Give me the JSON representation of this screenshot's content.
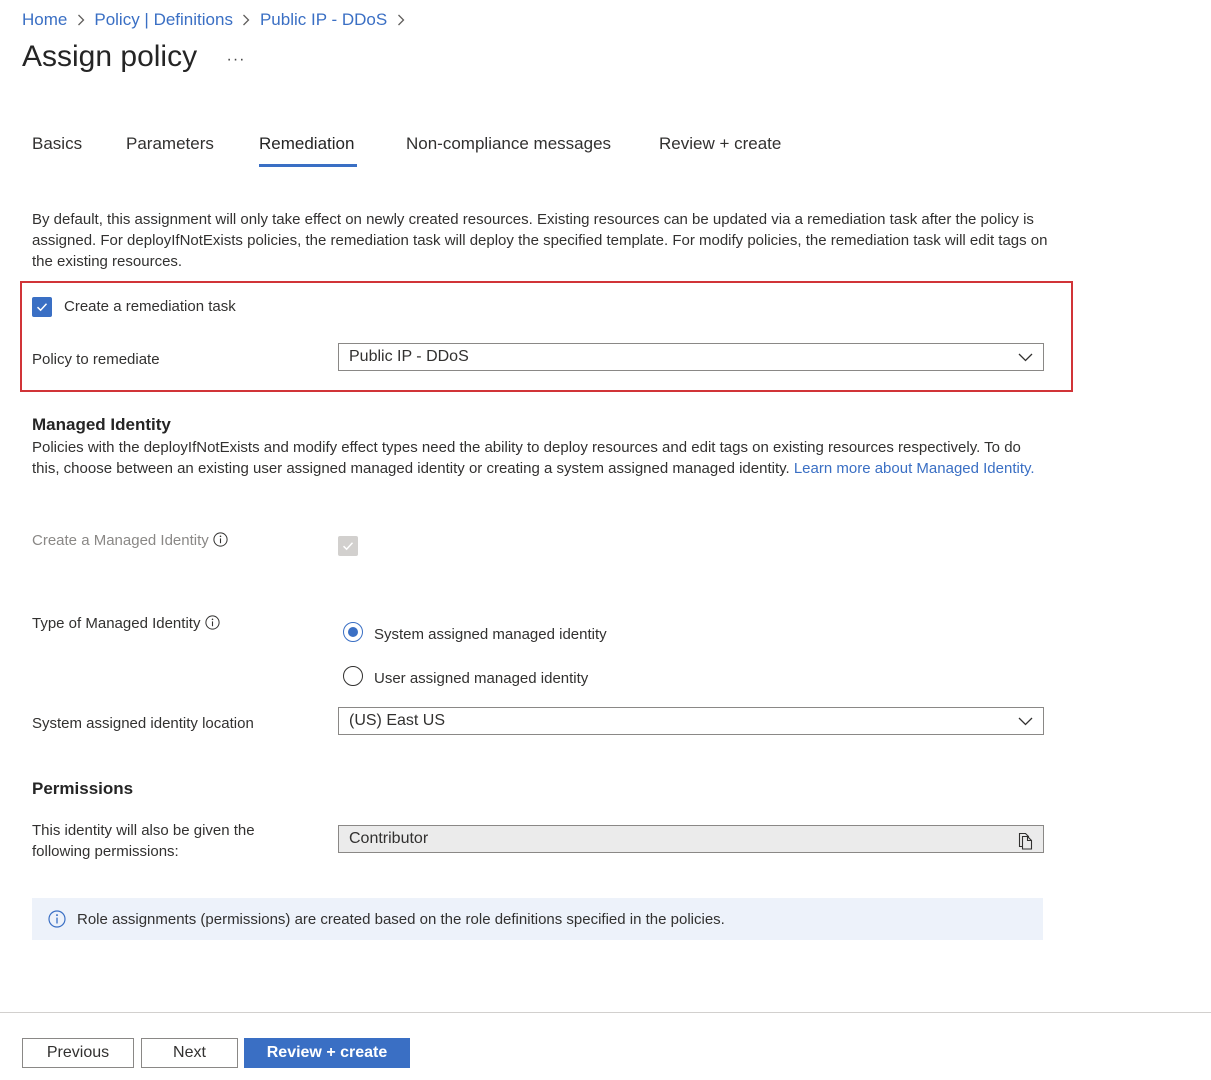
{
  "breadcrumb": {
    "items": [
      "Home",
      "Policy | Definitions",
      "Public IP - DDoS"
    ]
  },
  "page": {
    "title": "Assign policy",
    "more_label": "···"
  },
  "tabs": [
    {
      "label": "Basics"
    },
    {
      "label": "Parameters"
    },
    {
      "label": "Remediation",
      "active": true
    },
    {
      "label": "Non-compliance messages"
    },
    {
      "label": "Review + create"
    }
  ],
  "remediation": {
    "intro": "By default, this assignment will only take effect on newly created resources. Existing resources can be updated via a remediation task after the policy is assigned. For deployIfNotExists policies, the remediation task will deploy the specified template. For modify policies, the remediation task will edit tags on the existing resources.",
    "create_task_label": "Create a remediation task",
    "create_task_checked": true,
    "policy_label": "Policy to remediate",
    "policy_value": "Public IP - DDoS"
  },
  "managed_identity": {
    "title": "Managed Identity",
    "description": "Policies with the deployIfNotExists and modify effect types need the ability to deploy resources and edit tags on existing resources respectively. To do this, choose between an existing user assigned managed identity or creating a system assigned managed identity.",
    "learn_more": "Learn more about Managed Identity.",
    "create_label": "Create a Managed Identity",
    "create_checked": true,
    "type_label": "Type of Managed Identity",
    "options": [
      "System assigned managed identity",
      "User assigned managed identity"
    ],
    "selected_option": "System assigned managed identity",
    "location_label": "System assigned identity location",
    "location_value": "(US) East US"
  },
  "permissions": {
    "title": "Permissions",
    "label": "This identity will also be given the following permissions:",
    "value": "Contributor"
  },
  "info_banner": {
    "text": "Role assignments (permissions) are created based on the role definitions specified in the policies."
  },
  "footer": {
    "previous_label": "Previous",
    "next_label": "Next",
    "review_label": "Review + create"
  },
  "colors": {
    "accent": "#3a6fc4",
    "highlight_border": "#d13438",
    "banner_bg": "#edf2fa"
  }
}
